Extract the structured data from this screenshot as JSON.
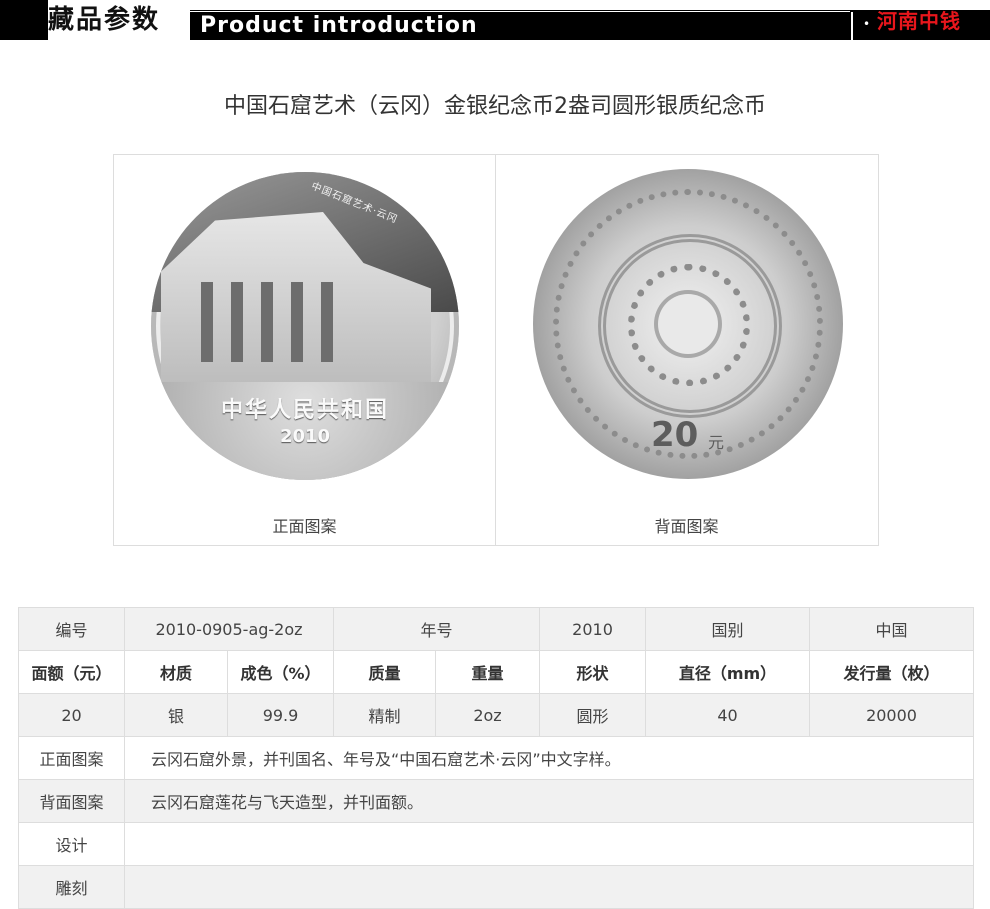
{
  "header": {
    "section_cn": "藏品参数",
    "section_en": "Product introduction",
    "brand_dot": "•",
    "brand": "河南中钱"
  },
  "title": "中国石窟艺术（云冈）金银纪念币2盎司圆形银质纪念币",
  "images": {
    "obverse": {
      "caption": "正面图案",
      "coin_arc_text": "中国石窟艺术·云冈",
      "coin_country": "中华人民共和国",
      "coin_year": "2010"
    },
    "reverse": {
      "caption": "背面图案",
      "coin_value": "20",
      "coin_unit": "元"
    }
  },
  "table": {
    "row1": {
      "l1": "编号",
      "v1": "2010-0905-ag-2oz",
      "l2": "年号",
      "v2": "2010",
      "l3": "国别",
      "v3": "中国"
    },
    "headers": [
      "面额（元）",
      "材质",
      "成色（%）",
      "质量",
      "重量",
      "形状",
      "直径（mm）",
      "发行量（枚）"
    ],
    "values": [
      "20",
      "银",
      "99.9",
      "精制",
      "2oz",
      "圆形",
      "40",
      "20000"
    ],
    "obverse_label": "正面图案",
    "obverse_desc": "云冈石窟外景，并刊国名、年号及“中国石窟艺术·云冈”中文字样。",
    "reverse_label": "背面图案",
    "reverse_desc": "云冈石窟莲花与飞天造型，并刊面额。",
    "design_label": "设计",
    "design_value": "",
    "engrave_label": "雕刻",
    "engrave_value": ""
  },
  "colors": {
    "brand_red": "#e8161c",
    "header_black": "#000000",
    "row_shade": "#f1f1f1",
    "border": "#dddddd"
  }
}
